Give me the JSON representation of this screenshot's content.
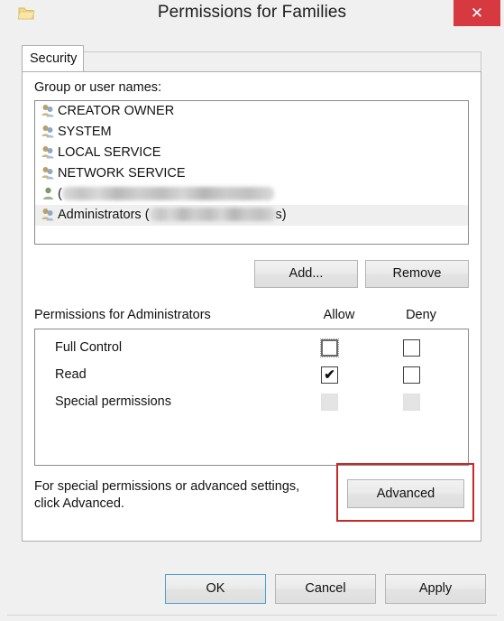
{
  "window": {
    "title": "Permissions for Families",
    "icon": "folder-icon",
    "close_label": "✕",
    "close_color": "#d6393f"
  },
  "tabs": [
    {
      "label": "Security",
      "selected": true
    }
  ],
  "security": {
    "group_label": "Group or user names:",
    "users": [
      {
        "name": "CREATOR OWNER",
        "icon": "group-icon",
        "redacted": false,
        "selected": false
      },
      {
        "name": "SYSTEM",
        "icon": "group-icon",
        "redacted": false,
        "selected": false
      },
      {
        "name": "LOCAL SERVICE",
        "icon": "group-icon",
        "redacted": false,
        "selected": false
      },
      {
        "name": "NETWORK SERVICE",
        "icon": "group-icon",
        "redacted": false,
        "selected": false
      },
      {
        "name": "(",
        "icon": "user-icon",
        "redacted": true,
        "redacted_width": 235,
        "suffix": "",
        "selected": false
      },
      {
        "name": "Administrators (",
        "icon": "group-icon",
        "redacted": true,
        "redacted_width": 140,
        "suffix": "s)",
        "selected": true
      }
    ],
    "add_button": "Add...",
    "remove_button": "Remove",
    "permissions_label": "Permissions for Administrators",
    "columns": {
      "allow": "Allow",
      "deny": "Deny"
    },
    "permissions": [
      {
        "name": "Full Control",
        "allow": "unchecked-focused",
        "deny": "unchecked"
      },
      {
        "name": "Read",
        "allow": "checked",
        "deny": "unchecked"
      },
      {
        "name": "Special permissions",
        "allow": "disabled",
        "deny": "disabled"
      }
    ],
    "checkmark": "✔",
    "advanced_hint": "For special permissions or advanced settings, click Advanced.",
    "advanced_button": "Advanced",
    "annotation_color": "#c62a2a"
  },
  "footer": {
    "ok": "OK",
    "cancel": "Cancel",
    "apply": "Apply"
  }
}
